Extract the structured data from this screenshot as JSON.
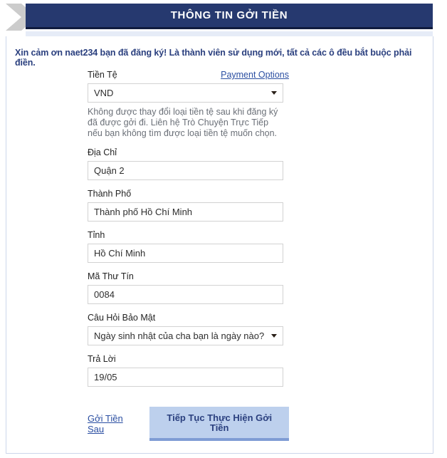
{
  "header": {
    "title": "THÔNG TIN GỞI TIỀN",
    "chevron_icon": "chevron-right-icon",
    "bar_color": "#26396f",
    "chevron_color": "#cccccc"
  },
  "notice": {
    "message": "Xin cảm ơn naet234 bạn đã đăng ký! Là thành viên sử dụng mới, tất cả các ô đều bắt buộc phải điền.",
    "color": "#2a3f7e"
  },
  "form": {
    "currency": {
      "label": "Tiền Tệ",
      "payment_options_link": "Payment Options",
      "value": "VND",
      "options": [
        "VND"
      ],
      "helper": "Không được thay đổi loại tiền tệ sau khi đăng ký đã được gởi đi. Liên hệ Trò Chuyện Trực Tiếp nếu bạn không tìm được loại tiền tệ muốn chọn."
    },
    "address": {
      "label": "Địa Chỉ",
      "value": "Quận 2",
      "placeholder": ""
    },
    "city": {
      "label": "Thành Phố",
      "value": "Thành phố Hồ Chí Minh",
      "placeholder": ""
    },
    "province": {
      "label": "Tỉnh",
      "value": "Hồ Chí Minh",
      "placeholder": ""
    },
    "postal_code": {
      "label": "Mã Thư Tín",
      "value": "0084",
      "placeholder": ""
    },
    "security_question": {
      "label": "Câu Hỏi Bảo Mật",
      "value": "Ngày sinh nhật của cha bạn là ngày nào?",
      "options": [
        "Ngày sinh nhật của cha bạn là ngày nào?"
      ]
    },
    "answer": {
      "label": "Trả Lời",
      "value": "19/05",
      "placeholder": ""
    }
  },
  "actions": {
    "later_link": "Gởi Tiền Sau",
    "submit_label": "Tiếp Tục Thực Hiện Gởi Tiền",
    "submit_bg": "#bdd0ed",
    "submit_text_color": "#2a3f7e"
  }
}
